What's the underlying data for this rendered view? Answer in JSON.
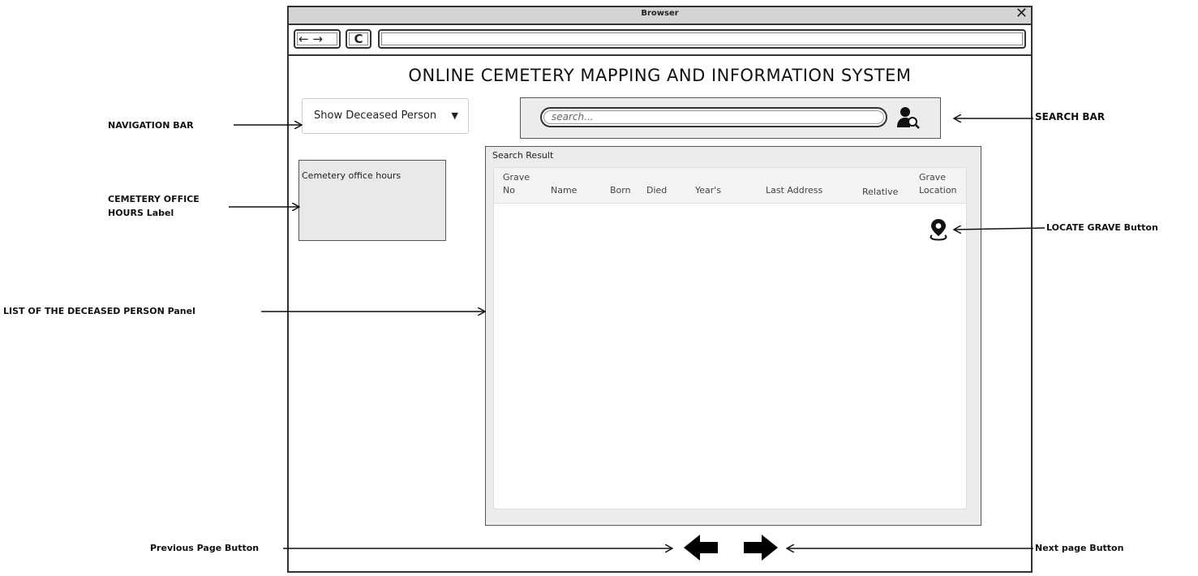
{
  "browser": {
    "title": "Browser",
    "close_glyph": "✕",
    "back_forward": "← →",
    "reload_glyph": "C",
    "url": ""
  },
  "app": {
    "title": "ONLINE CEMETERY MAPPING AND INFORMATION SYSTEM",
    "nav_select": {
      "value": "Show Deceased Person",
      "caret": "▼"
    },
    "search": {
      "placeholder": "search...",
      "icon": "user-search-icon"
    },
    "office_hours_label": "Cemetery office hours",
    "result": {
      "label": "Search Result",
      "columns": [
        {
          "line1": "Grave",
          "line2": "No"
        },
        {
          "line1": "",
          "line2": "Name"
        },
        {
          "line1": "",
          "line2": "Born"
        },
        {
          "line1": "",
          "line2": "Died"
        },
        {
          "line1": "",
          "line2": "Year's"
        },
        {
          "line1": "",
          "line2": "Last Address"
        },
        {
          "line1": "",
          "line2": "Relative"
        },
        {
          "line1": "Grave",
          "line2": "Location"
        }
      ],
      "locate_icon": "map-pin-icon"
    },
    "pager": {
      "prev_icon": "arrow-left-icon",
      "next_icon": "arrow-right-icon"
    }
  },
  "annotations": {
    "navigation_bar": "NAVIGATION BAR",
    "office_hours": "CEMETERY OFFICE HOURS Label",
    "office_hours_line1": "CEMETERY OFFICE",
    "office_hours_line2": "HOURS Label",
    "list_panel": "LIST OF THE DECEASED PERSON Panel",
    "prev_button": "Previous Page Button",
    "search_bar": "SEARCH BAR",
    "locate_button": "LOCATE GRAVE Button",
    "next_button": "Next page Button"
  }
}
